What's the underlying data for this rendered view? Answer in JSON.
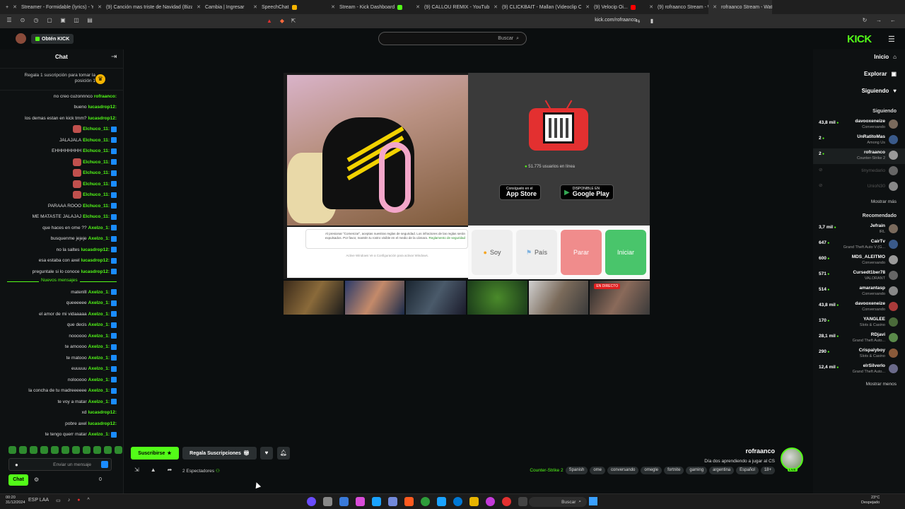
{
  "browser": {
    "tabs": [
      {
        "label": "rofraanco Stream - Watch Li...",
        "active": true,
        "color": "#53fc18"
      },
      {
        "label": "(9) rofraanco Stream - Watch Li...",
        "color": "#53fc18"
      },
      {
        "label": "(9) Velocip Oi...",
        "color": "#ff0000"
      },
      {
        "label": "(9) CLICKBAIT - Mallan (Videoclip Oficial) - YouTube",
        "color": "#ff0000"
      },
      {
        "label": "(9) CALLOU REMIX - YouTube",
        "color": "#ff0000"
      },
      {
        "label": "Stream - Kick Dashboard",
        "color": "#53fc18"
      },
      {
        "label": "SpeechChat",
        "color": "#f5b400"
      },
      {
        "label": "Cambia | Ingresar",
        "color": "#888888"
      },
      {
        "label": "(9) Canción mas triste de Navidad (Bizarrap...",
        "color": "#ff0000"
      },
      {
        "label": "Streamer - Formidable (lyrics) - YouT...",
        "color": "#ff0000"
      }
    ],
    "url": "kick.com/rofraanco"
  },
  "topbar": {
    "get_kick": "Obtén KICK",
    "search_placeholder": "Buscar",
    "logo": "KICK"
  },
  "chat": {
    "title": "Chat",
    "gift_text": "Regala 1 suscripción para tomar la posición 1",
    "messages": [
      {
        "user": "rofraanco:",
        "text": "no creo cuzonnnco",
        "color": "green"
      },
      {
        "user": "lucasdrop12:",
        "text": "bueno",
        "color": "green"
      },
      {
        "user": "lucasdrop12:",
        "text": "los demas estan en kick tmm?",
        "color": "green"
      },
      {
        "user": "Elchuco_11:",
        "text": "",
        "color": "green"
      },
      {
        "user": "Elchuco_11:",
        "text": "JALAJALA",
        "color": "green"
      },
      {
        "user": "Elchuco_11:",
        "text": "EHHHHHHHH",
        "color": "green"
      },
      {
        "user": "Elchuco_11:",
        "text": "",
        "color": "green"
      },
      {
        "user": "Elchuco_11:",
        "text": "",
        "color": "green"
      },
      {
        "user": "Elchuco_11:",
        "text": "",
        "color": "green"
      },
      {
        "user": "Elchuco_11:",
        "text": "",
        "color": "green"
      },
      {
        "user": "Elchuco_11:",
        "text": "PARAAA ROOO",
        "color": "green"
      },
      {
        "user": "Elchuco_11:",
        "text": "ME MATASTE JALAJAJ",
        "color": "green"
      },
      {
        "user": "Axelzo_1:",
        "text": "que haces en ome ??",
        "color": "green"
      },
      {
        "user": "Axelzo_1:",
        "text": "busquenme jejeje",
        "color": "green"
      },
      {
        "user": "lucasdrop12:",
        "text": "no la saltes",
        "color": "green"
      },
      {
        "user": "lucasdrop12:",
        "text": "esa estaba con axel",
        "color": "green"
      },
      {
        "user": "lucasdrop12:",
        "text": "preguntale si lo conoce",
        "color": "green"
      }
    ],
    "new_messages_label": "Nuevos mensajes",
    "new_messages": [
      {
        "user": "Axelzo_1:",
        "text": "matenlll"
      },
      {
        "user": "Axelzo_1:",
        "text": "queeeeee"
      },
      {
        "user": "Axelzo_1:",
        "text": "el amor de mi vidaaaaa"
      },
      {
        "user": "Axelzo_1:",
        "text": "que decis"
      },
      {
        "user": "Axelzo_1:",
        "text": "noooooo"
      },
      {
        "user": "Axelzo_1:",
        "text": "te amoooo"
      },
      {
        "user": "Axelzo_1:",
        "text": "te matooo"
      },
      {
        "user": "Axelzo_1:",
        "text": "euuuuu"
      },
      {
        "user": "Axelzo_1:",
        "text": "nolooooo"
      },
      {
        "user": "Axelzo_1:",
        "text": "la concha de tu madreeeeee"
      },
      {
        "user": "Axelzo_1:",
        "text": "te voy a matar"
      },
      {
        "user": "lucasdrop12:",
        "text": "xd"
      },
      {
        "user": "lucasdrop12:",
        "text": "pobre axel"
      },
      {
        "user": "Axelzo_1:",
        "text": "te tengo querr matar"
      }
    ],
    "input_placeholder": "Enviar un mensaje",
    "chat_button": "Chat",
    "count": "0"
  },
  "player": {
    "online_text": "51.775 usuarios en línea",
    "google_play_small": "DISPONIBLE EN",
    "google_play": "Google Play",
    "app_store_small": "Consíguelo en el",
    "app_store": "App Store",
    "consent_text": "Al presionar \"Comenzar\", aceptas nuestras reglas de seguridad. Los infractores de las reglas serán expulsados. Por favor, mantén tu rostro visible en el medio de la cámara.",
    "consent_link": "Reglamento de seguridad",
    "consent_sub": "Active Windows Ve a Configuración para activar Windows.",
    "btn_iniciar": "Iniciar",
    "btn_parar": "Parar",
    "btn_pais": "País",
    "btn_soy": "Soy",
    "thumb_live": "EN DIRECTO"
  },
  "actions": {
    "subscribe": "Suscribirse",
    "gift_subs": "Regala Suscripciones",
    "viewers": "2 Espectadores"
  },
  "channel": {
    "name": "rofraanco",
    "title": "Día dos aprendiendo a jugar al CS",
    "category": "Counter-Strike 2",
    "language": "Spanish",
    "tags": [
      "18+",
      "Español",
      "argentina",
      "gaming",
      "fortnite",
      "omegle",
      "conversando",
      "ome"
    ],
    "live_badge": "LIVE"
  },
  "sidebar": {
    "nav": [
      {
        "label": "Inicio",
        "icon": "home-icon"
      },
      {
        "label": "Explorar",
        "icon": "compass-icon"
      },
      {
        "label": "Siguiendo",
        "icon": "heart-icon"
      }
    ],
    "following_title": "Siguiendo",
    "following": [
      {
        "name": "davooxeneize",
        "game": "Conversando",
        "viewers": "43,8 mil"
      },
      {
        "name": "UnRatitoMas",
        "game": "Among Us",
        "viewers": "2"
      },
      {
        "name": "rofraanco",
        "game": "Counter-Strike 2",
        "viewers": "2",
        "active": true
      },
      {
        "name": "tinymedario",
        "game": "",
        "viewers": "",
        "offline": true
      },
      {
        "name": "UnioN30",
        "game": "",
        "viewers": "",
        "offline": true
      }
    ],
    "show_more": "Mostrar más",
    "recommended_title": "Recomendado",
    "recommended": [
      {
        "name": "Jefrain",
        "game": "IRL",
        "viewers": "3,7 mil"
      },
      {
        "name": "CairTv",
        "game": "Grand Theft Auto V (G...",
        "viewers": "647"
      },
      {
        "name": "MDS_ALEITMO",
        "game": "Conversando",
        "viewers": "600"
      },
      {
        "name": "Cursedt1ber78",
        "game": "VALORANT",
        "viewers": "571"
      },
      {
        "name": "amarantasp",
        "game": "Conversando",
        "viewers": "514"
      },
      {
        "name": "davooxeneize",
        "game": "Conversando",
        "viewers": "43,8 mil"
      },
      {
        "name": "YANGLEE",
        "game": "Slots & Casino",
        "viewers": "170"
      },
      {
        "name": "RDjavi",
        "game": "Grand Theft Auto...",
        "viewers": "28,1 mil"
      },
      {
        "name": "Crispalyboy",
        "game": "Slots & Casino",
        "viewers": "290"
      },
      {
        "name": "elrSilverlo",
        "game": "Grand Theft Auto...",
        "viewers": "12,4 mil"
      }
    ],
    "show_less": "Mostrar menos"
  },
  "taskbar": {
    "search": "Buscar",
    "time": "00:20",
    "date": "31/12/2024",
    "temp": "23°C",
    "weather": "Despejado",
    "lang": "ESP LAA"
  }
}
